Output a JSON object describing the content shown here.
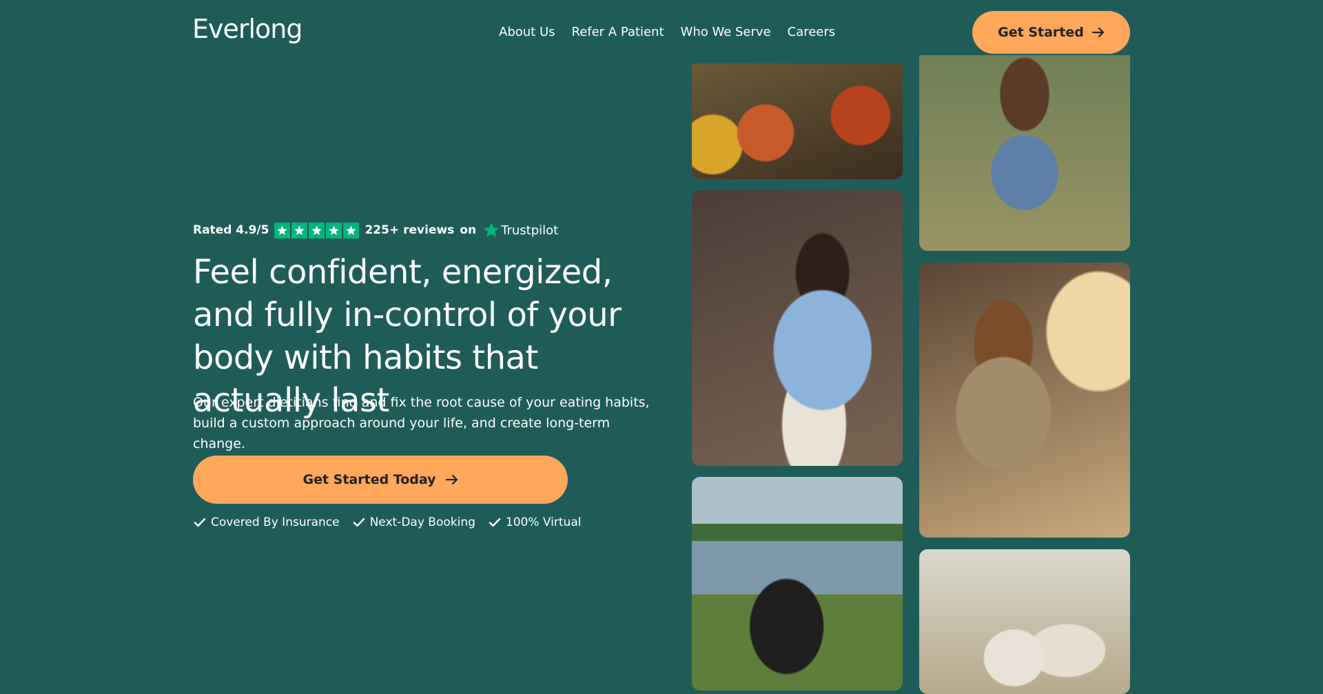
{
  "brand": {
    "logo_text": "Everlong",
    "accent_color": "#ffa75a",
    "background_color": "#1f5c58",
    "trustpilot_green": "#00b67a"
  },
  "nav": {
    "items": [
      "About Us",
      "Refer A Patient",
      "Who We Serve",
      "Careers"
    ]
  },
  "header": {
    "cta_label": "Get Started",
    "cta_icon": "arrow-right-icon"
  },
  "rating": {
    "prefix": "Rated 4.9/5",
    "stars": 5,
    "reviews": "225+ reviews",
    "on": "on",
    "platform": "Trustpilot"
  },
  "hero": {
    "headline": "Feel confident, energized, and fully in-control of your body with habits that actually last",
    "subtext": "Our expert dietitians find and fix the root cause of your eating habits, build a custom approach around your life, and create long-term change.",
    "cta_label": "Get Started Today",
    "cta_icon": "arrow-right-icon"
  },
  "features": [
    "Covered By Insurance",
    "Next-Day Booking",
    "100% Virtual"
  ],
  "photos": [
    "food-spread-photo",
    "woman-hiking-photo",
    "woman-dining-photo",
    "woman-eating-photo",
    "woman-stretching-by-lake-photo",
    "family-walking-photo"
  ]
}
